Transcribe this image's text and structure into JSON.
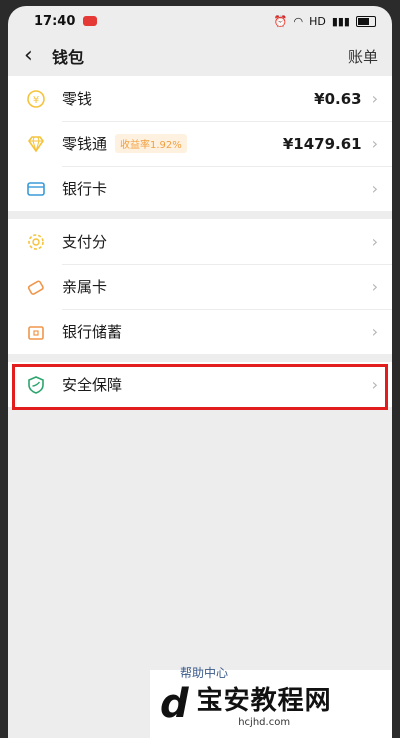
{
  "status": {
    "time": "17:40",
    "network": "HD"
  },
  "nav": {
    "title": "钱包",
    "bill": "账单"
  },
  "groups": [
    {
      "items": [
        {
          "label": "零钱",
          "value": "¥0.63"
        },
        {
          "label": "零钱通",
          "badge": "收益率1.92%",
          "value": "¥1479.61"
        },
        {
          "label": "银行卡"
        }
      ]
    },
    {
      "items": [
        {
          "label": "支付分"
        },
        {
          "label": "亲属卡"
        },
        {
          "label": "银行储蓄"
        }
      ]
    },
    {
      "items": [
        {
          "label": "安全保障"
        }
      ]
    }
  ],
  "footer": {
    "help": "帮助中心",
    "watermark": "宝安教程网",
    "site": "hcjhd.com"
  },
  "colors": {
    "highlight": "#e21d1d",
    "coin": "#f5c33b",
    "card": "#3a9bd8",
    "shield": "#2ca56d"
  }
}
